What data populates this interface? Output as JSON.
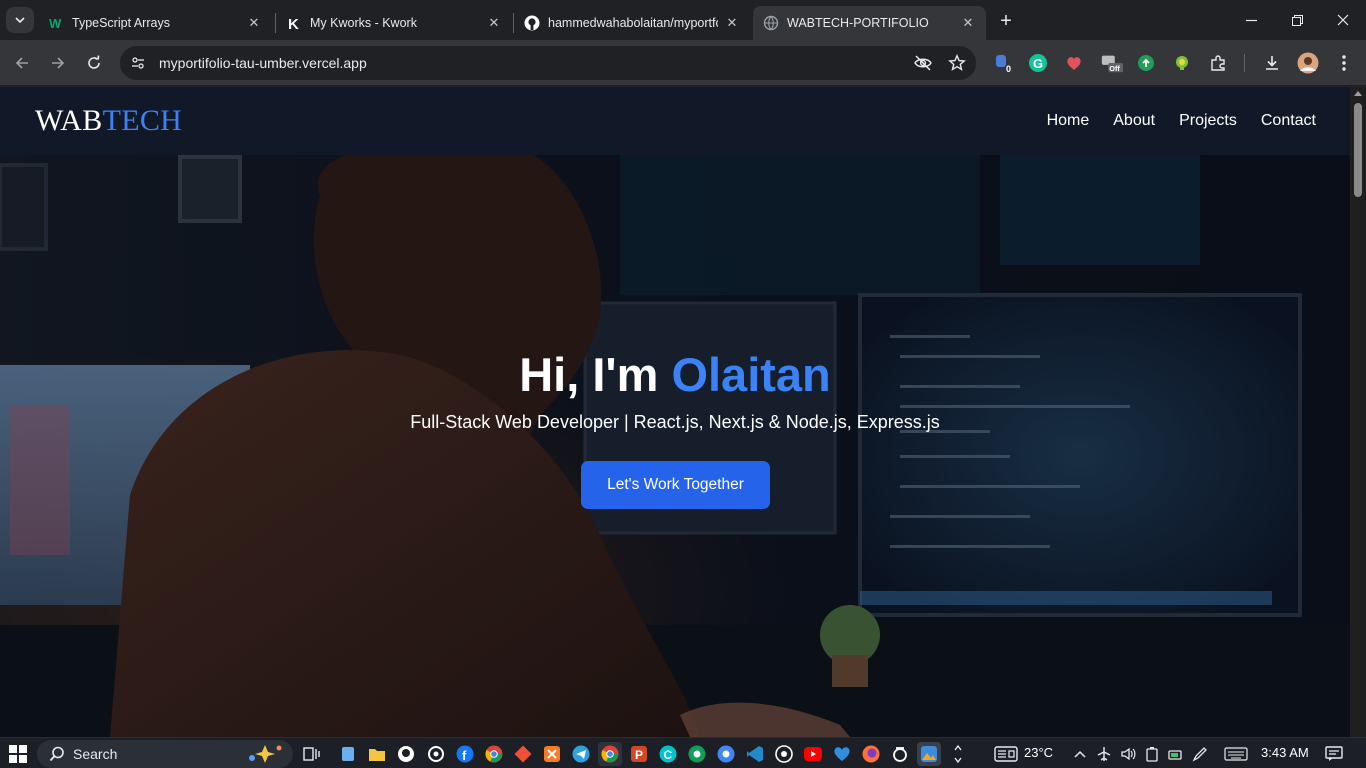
{
  "browser": {
    "tabs": [
      {
        "title": "TypeScript Arrays",
        "favicon": "w3schools-icon",
        "active": false
      },
      {
        "title": "My Kworks - Kwork",
        "favicon": "kwork-icon",
        "active": false
      },
      {
        "title": "hammedwahabolaitan/myportfoli",
        "favicon": "github-icon",
        "active": false
      },
      {
        "title": "WABTECH-PORTIFOLIO",
        "favicon": "globe-icon",
        "active": true
      }
    ],
    "url": "myportifolio-tau-umber.vercel.app",
    "extension_badges": {
      "first": "0",
      "camera": "Off"
    }
  },
  "site": {
    "logo_part1": "WAB",
    "logo_part2": "TECH",
    "nav": [
      "Home",
      "About",
      "Projects",
      "Contact"
    ],
    "hero": {
      "title_prefix": "Hi, I'm ",
      "title_highlight": "Olaitan",
      "subtitle": "Full-Stack Web Developer | React.js, Next.js & Node.js, Express.js",
      "cta": "Let's Work Together"
    }
  },
  "colors": {
    "accent": "#3b82f6",
    "button": "#2563eb",
    "header_bg": "#111827"
  },
  "taskbar": {
    "search_label": "Search",
    "weather": "23°C",
    "time": "3:43 AM"
  }
}
